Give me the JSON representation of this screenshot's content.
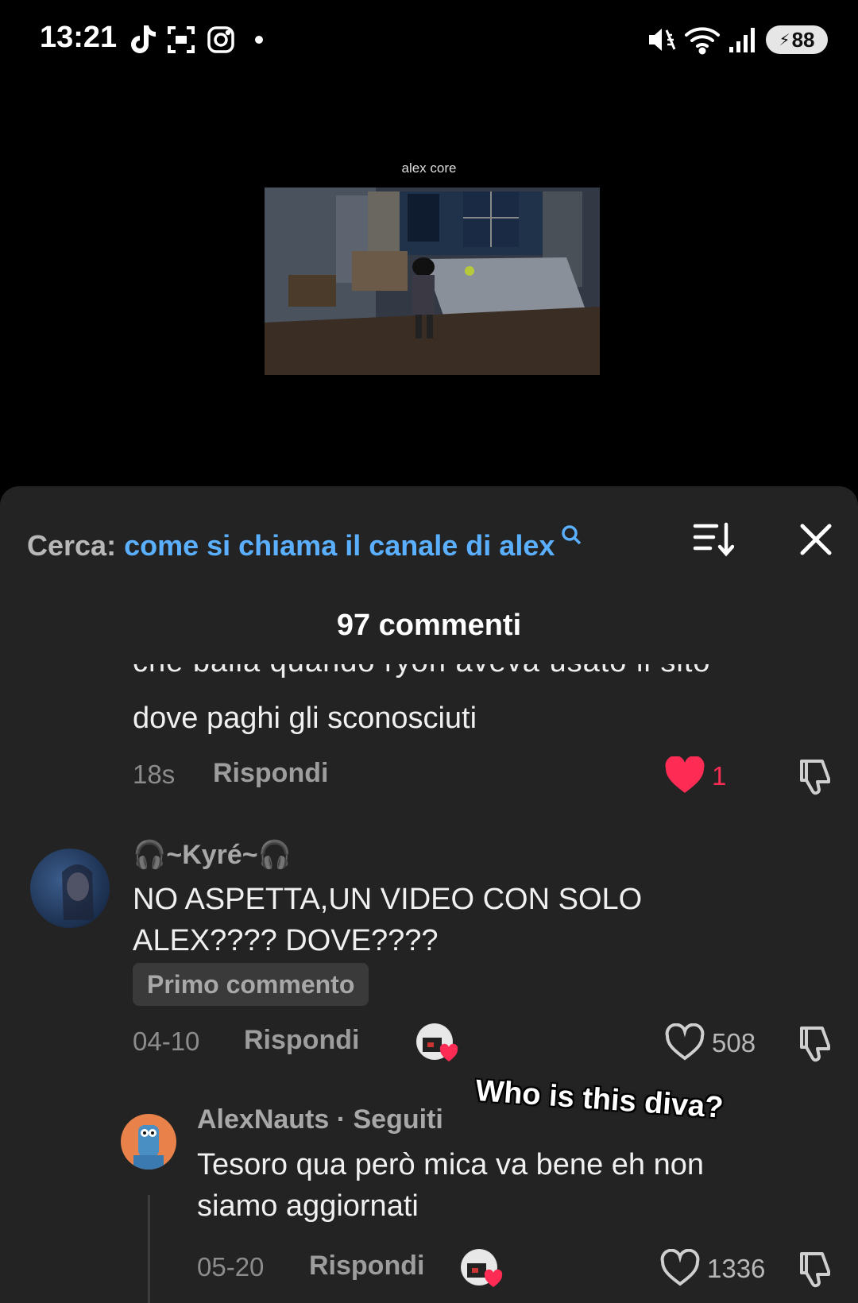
{
  "status_bar": {
    "time": "13:21",
    "battery": "88",
    "icons": [
      "tiktok-icon",
      "screen-capture-icon",
      "instagram-icon",
      "notification-dot-icon",
      "mute-vibrate-icon",
      "wifi-icon",
      "signal-icon",
      "battery-icon"
    ]
  },
  "video": {
    "caption": "alex core"
  },
  "search": {
    "prefix": "Cerca:",
    "query": "come si chiama il canale di alex",
    "icon": "search-icon"
  },
  "comments_header": {
    "title": "97 commenti"
  },
  "comments": [
    {
      "partial_line": "che balla quando ryon aveva usato il sito",
      "text_line": "dove paghi gli sconosciuti",
      "date": "18s",
      "reply_label": "Rispondi",
      "likes": "1",
      "liked": true
    },
    {
      "username": "🎧~Kyré~🎧",
      "text_line1": "NO ASPETTA,UN VIDEO CON SOLO",
      "text_line2": "ALEX???? DOVE????",
      "badge": "Primo commento",
      "date": "04-10",
      "reply_label": "Rispondi",
      "likes": "508",
      "liked": false
    },
    {
      "username": "AlexNauts · Seguiti",
      "text_line1": "Tesoro qua però mica va bene eh non",
      "text_line2": "siamo aggiornati",
      "date": "05-20",
      "reply_label": "Rispondi",
      "likes": "1336",
      "liked": false
    }
  ],
  "overlay_caption": "Who is this diva?",
  "colors": {
    "sheet_bg": "#232323",
    "link_blue": "#5ab0ff",
    "like_red": "#fe2c55",
    "muted_text": "#8c8c8c"
  }
}
